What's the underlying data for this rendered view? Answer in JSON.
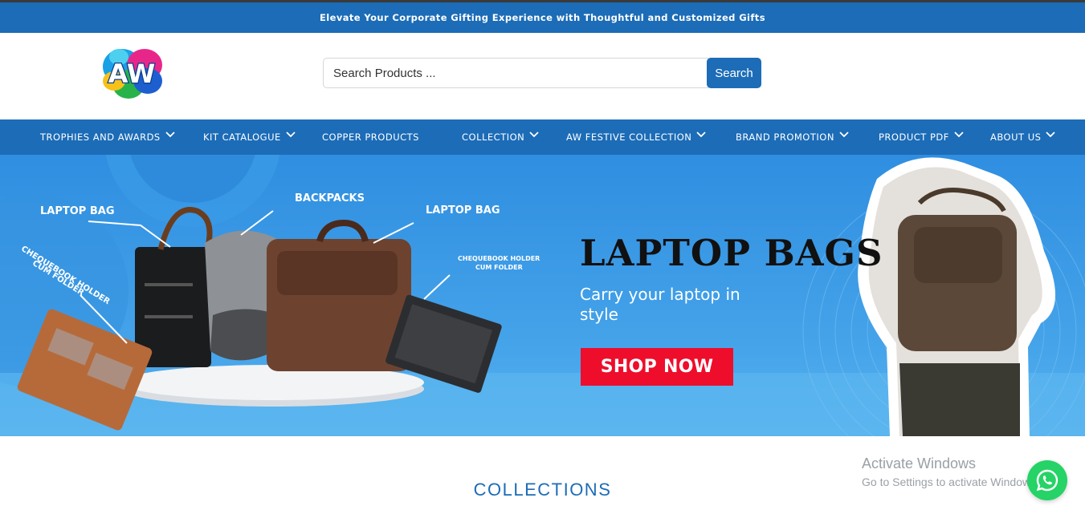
{
  "announcement": {
    "text": "Elevate Your Corporate Gifting Experience with Thoughtful and Customized Gifts"
  },
  "header": {
    "logo_text": "AW",
    "search": {
      "placeholder": "Search Products ...",
      "button_label": "Search"
    }
  },
  "nav": {
    "items": [
      {
        "label": "TROPHIES AND AWARDS",
        "has_dropdown": true
      },
      {
        "label": "KIT CATALOGUE",
        "has_dropdown": true
      },
      {
        "label": "COPPER PRODUCTS",
        "has_dropdown": false
      },
      {
        "label": "COLLECTION",
        "has_dropdown": true
      },
      {
        "label": "AW FESTIVE COLLECTION",
        "has_dropdown": true
      },
      {
        "label": "BRAND PROMOTION",
        "has_dropdown": true
      },
      {
        "label": "PRODUCT PDF",
        "has_dropdown": true
      },
      {
        "label": "ABOUT US",
        "has_dropdown": true
      }
    ]
  },
  "hero": {
    "title": "LAPTOP BAGS",
    "subtitle": "Carry your laptop in style",
    "cta_label": "SHOP NOW",
    "labels": {
      "laptop_bag_left": "LAPTOP BAG",
      "backpacks": "BACKPACKS",
      "laptop_bag_right": "LAPTOP BAG",
      "cheque_left_1": "CHEQUEBOOK HOLDER",
      "cheque_left_2": "CUM FOLDER",
      "cheque_right_1": "CHEQUEBOOK HOLDER",
      "cheque_right_2": "CUM FOLDER"
    }
  },
  "collections_heading": "COLLECTIONS",
  "os_watermark": {
    "line1": "Activate Windows",
    "line2": "Go to Settings to activate Windows."
  },
  "colors": {
    "brand_blue": "#1c6cb7",
    "cta_red": "#ee0d2b",
    "whatsapp_green": "#25d366"
  }
}
